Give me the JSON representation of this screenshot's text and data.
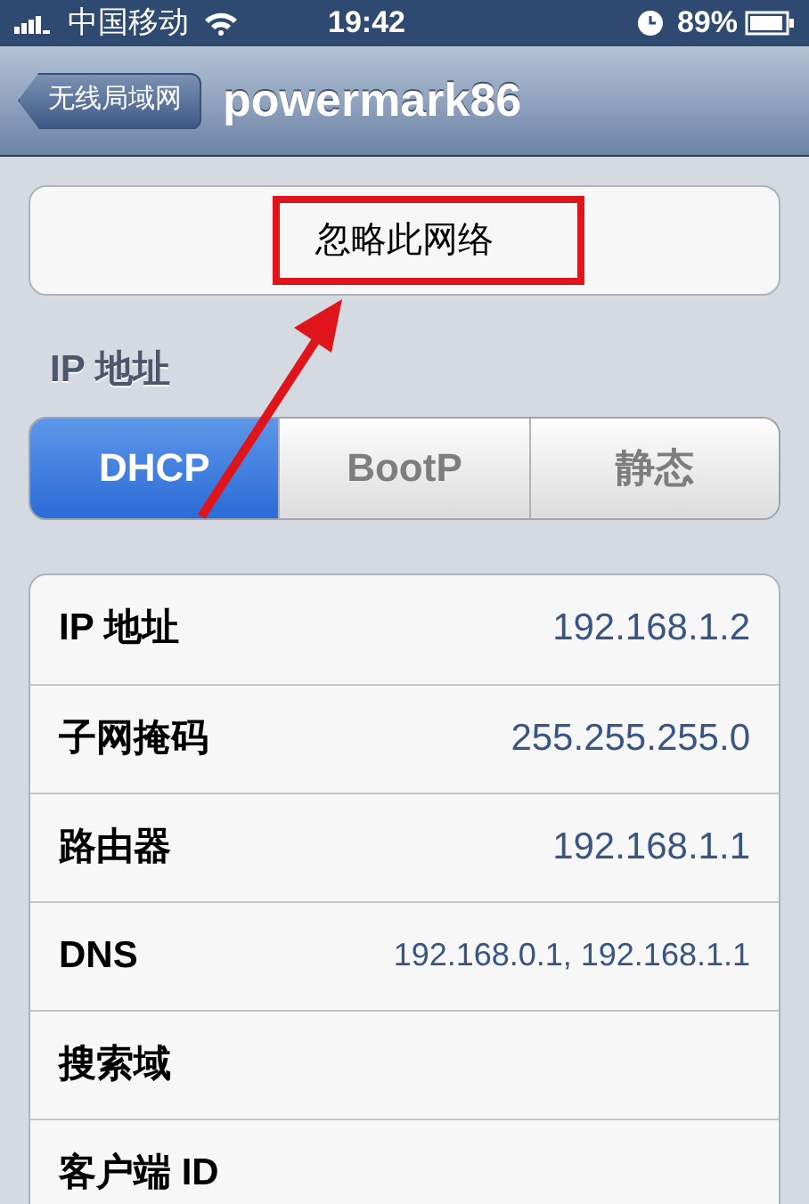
{
  "status_bar": {
    "carrier": "中国移动",
    "time": "19:42",
    "battery": "89%"
  },
  "nav_bar": {
    "back": "无线局域网",
    "title": "powermark86"
  },
  "forget_button": {
    "label": "忽略此网络"
  },
  "section": {
    "title": "IP 地址"
  },
  "segments": [
    {
      "label": "DHCP",
      "selected": true
    },
    {
      "label": "BootP",
      "selected": false
    },
    {
      "label": "静态",
      "selected": false
    }
  ],
  "rows": [
    {
      "label": "IP 地址",
      "value": "192.168.1.2"
    },
    {
      "label": "子网掩码",
      "value": "255.255.255.0"
    },
    {
      "label": "路由器",
      "value": "192.168.1.1"
    },
    {
      "label": "DNS",
      "value": "192.168.0.1, 192.168.1.1"
    },
    {
      "label": "搜索域"
    },
    {
      "label": "客户端 ID"
    }
  ]
}
